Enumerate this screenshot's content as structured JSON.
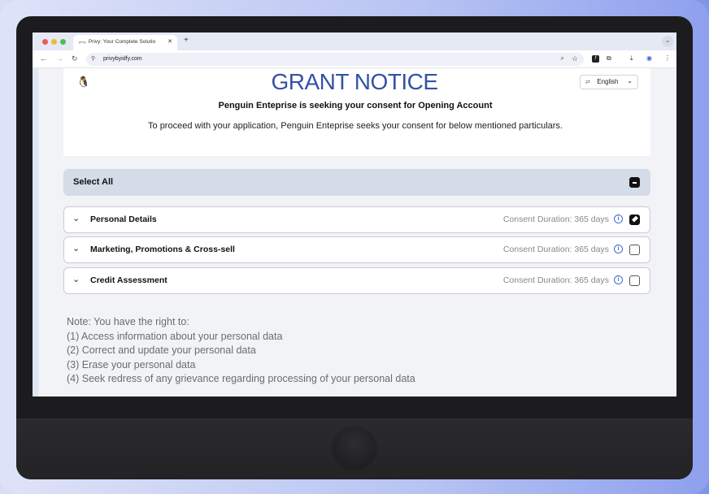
{
  "browser": {
    "tab_title": "Privy: Your Complete Solutio",
    "tab_favicon": "privy",
    "url": "privybyidfy.com",
    "nav": {
      "back": "←",
      "forward": "→",
      "reload": "↻"
    }
  },
  "header": {
    "title": "GRANT NOTICE",
    "language": "English",
    "subtitle": "Penguin Enteprise is seeking your consent for Opening Account",
    "description": "To proceed with your application, Penguin Enteprise seeks your consent for below mentioned particulars."
  },
  "consent": {
    "select_all_label": "Select All",
    "items": [
      {
        "label": "Personal Details",
        "duration": "Consent Duration: 365 days",
        "checked": true
      },
      {
        "label": "Marketing, Promotions & Cross-sell",
        "duration": "Consent Duration: 365 days",
        "checked": false
      },
      {
        "label": "Credit Assessment",
        "duration": "Consent Duration: 365 days",
        "checked": false
      }
    ]
  },
  "note": {
    "heading": "Note: You have the right to:",
    "lines": [
      "(1) Access information about your personal data",
      "(2) Correct and update your personal data",
      "(3) Erase your personal data",
      "(4) Seek redress of any grievance regarding processing of your personal data"
    ]
  },
  "colors": {
    "accent": "#3551a6",
    "info": "#3b66d6",
    "select_all_bg": "#d4dce8"
  }
}
